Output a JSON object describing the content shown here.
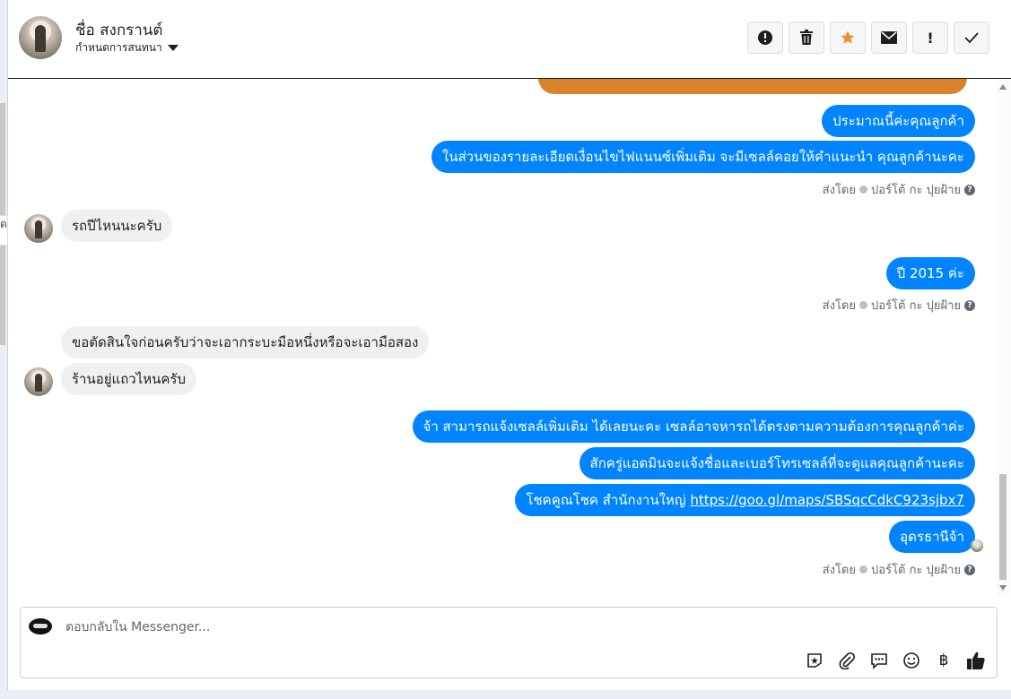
{
  "header": {
    "name": "ชื่อ สงกรานต์",
    "subtitle": "กำหนดการสนทนา",
    "toolbar": [
      {
        "icon": "alert-circle-icon",
        "glyph": "!"
      },
      {
        "icon": "trash-icon",
        "glyph": ""
      },
      {
        "icon": "star-icon",
        "glyph": "★"
      },
      {
        "icon": "envelope-icon",
        "glyph": "✉"
      },
      {
        "icon": "exclamation-icon",
        "glyph": "!"
      },
      {
        "icon": "check-icon",
        "glyph": "✓"
      }
    ],
    "accent": "#f28c28"
  },
  "messages": {
    "m1": "ประมาณนี้ค่ะคุณลูกค้า",
    "m2": "ในส่วนของรายละเอียดเงื่อนไขไฟแนนซ์เพิ่มเติม จะมีเซลล์คอยให้คำแนะนำ คุณลูกค้านะคะ",
    "m3": "รถปีไหนนะครับ",
    "m4": "ปี 2015 ค่ะ",
    "m5": "ขอตัดสินใจก่อนครับว่าจะเอากระบะมือหนึ่งหรือจะเอามือสอง",
    "m6": "ร้านอยู่แถวไหนครับ",
    "m7": "จ้า สามารถแจ้งเซลล์เพิ่มเติม ได้เลยนะคะ  เซลล์อาจหารถได้ตรงตามความต้องการคุณลูกค้าค่ะ",
    "m8": "สักครู่แอดมินจะแจ้งชื่อและเบอร์โทรเซลล์ที่จะดูแลคุณลูกค้านะคะ",
    "m9_prefix": "โชคคูณโชค สำนักงานใหญ่ ",
    "m9_link": "https://goo.gl/maps/SBSqcCdkC923sjbx7",
    "m10": "อุดรธานีจ้า",
    "sent_by_label": "ส่งโดย",
    "sent_by_name": "ปอร์โต้ กะ ปุยฝ้าย",
    "help": "?",
    "outgoing_color": "#0084ff",
    "incoming_color": "#f1f0f0"
  },
  "composer": {
    "placeholder": "ตอบกลับใน Messenger...",
    "tools": [
      "sticker-icon",
      "attachment-icon",
      "saved-reply-icon",
      "emoji-icon",
      "baht-icon",
      "like-icon"
    ],
    "baht": "฿"
  },
  "edge_char": "ต"
}
